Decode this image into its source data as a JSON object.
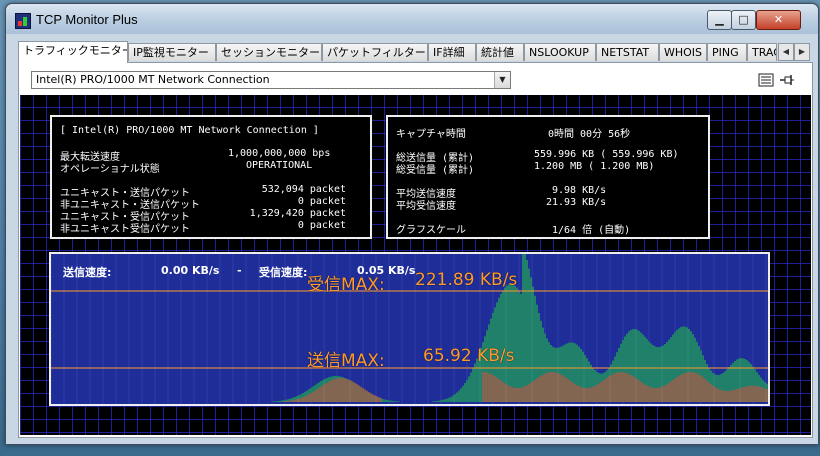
{
  "window": {
    "title": "TCP Monitor Plus",
    "min_glyph": "▁",
    "max_glyph": "□",
    "close_glyph": "✕"
  },
  "tabs": [
    {
      "label": "トラフィックモニター",
      "active": true
    },
    {
      "label": "IP監視モニター",
      "active": false
    },
    {
      "label": "セッションモニター",
      "active": false
    },
    {
      "label": "パケットフィルター",
      "active": false
    },
    {
      "label": "IF詳細",
      "active": false
    },
    {
      "label": "統計値",
      "active": false
    },
    {
      "label": "NSLOOKUP",
      "active": false
    },
    {
      "label": "NETSTAT",
      "active": false
    },
    {
      "label": "WHOIS",
      "active": false
    },
    {
      "label": "PING",
      "active": false
    },
    {
      "label": "TRACE",
      "active": false
    }
  ],
  "tab_scroll": {
    "left": "◀",
    "right": "▶"
  },
  "adapter": {
    "selected": "Intel(R) PRO/1000 MT Network Connection",
    "dropdown_glyph": "▼"
  },
  "toolbar_icons": [
    "list-icon",
    "pin-icon"
  ],
  "left_panel": {
    "title": "[ Intel(R) PRO/1000 MT Network Connection ]",
    "max_speed_label": "最大転送速度",
    "max_speed_value": "1,000,000,000 bps",
    "op_state_label": "オペレーショナル状態",
    "op_state_value": "OPERATIONAL",
    "packets": [
      {
        "label": "ユニキャスト・送信パケット",
        "value": "532,094 packet"
      },
      {
        "label": "非ユニキャスト・送信パケット",
        "value": "0 packet"
      },
      {
        "label": "ユニキャスト・受信パケット",
        "value": "1,329,420 packet"
      },
      {
        "label": "非ユニキャスト受信パケット",
        "value": "0 packet"
      }
    ]
  },
  "right_panel": {
    "capture_label": "キャプチャ時間",
    "capture_value": "0時間 00分 56秒",
    "total_sent_label": "総送信量 (累計)",
    "total_sent_value": "559.996 KB ( 559.996 KB)",
    "total_recv_label": "総受信量 (累計)",
    "total_recv_value": "1.200 MB (   1.200 MB)",
    "avg_sent_label": "平均送信速度",
    "avg_sent_value": "9.98 KB/s",
    "avg_recv_label": "平均受信速度",
    "avg_recv_value": "21.93 KB/s",
    "graph_scale_label": "グラフスケール",
    "graph_scale_value": "1/64 倍  (自動)"
  },
  "graph": {
    "send_speed_label": "送信速度:",
    "send_speed_value": "0.00 KB/s",
    "separator": "-",
    "recv_speed_label": "受信速度:",
    "recv_speed_value": "0.05 KB/s",
    "recv_max_label": "受信MAX:",
    "recv_max_value": "221.89 KB/s",
    "send_max_label": "送信MAX:",
    "send_max_value": "65.92 KB/s",
    "colors": {
      "background": "#1e2d98",
      "recv": "#22b84a",
      "send": "#d8762a",
      "maxline": "#ff9a2e"
    }
  }
}
